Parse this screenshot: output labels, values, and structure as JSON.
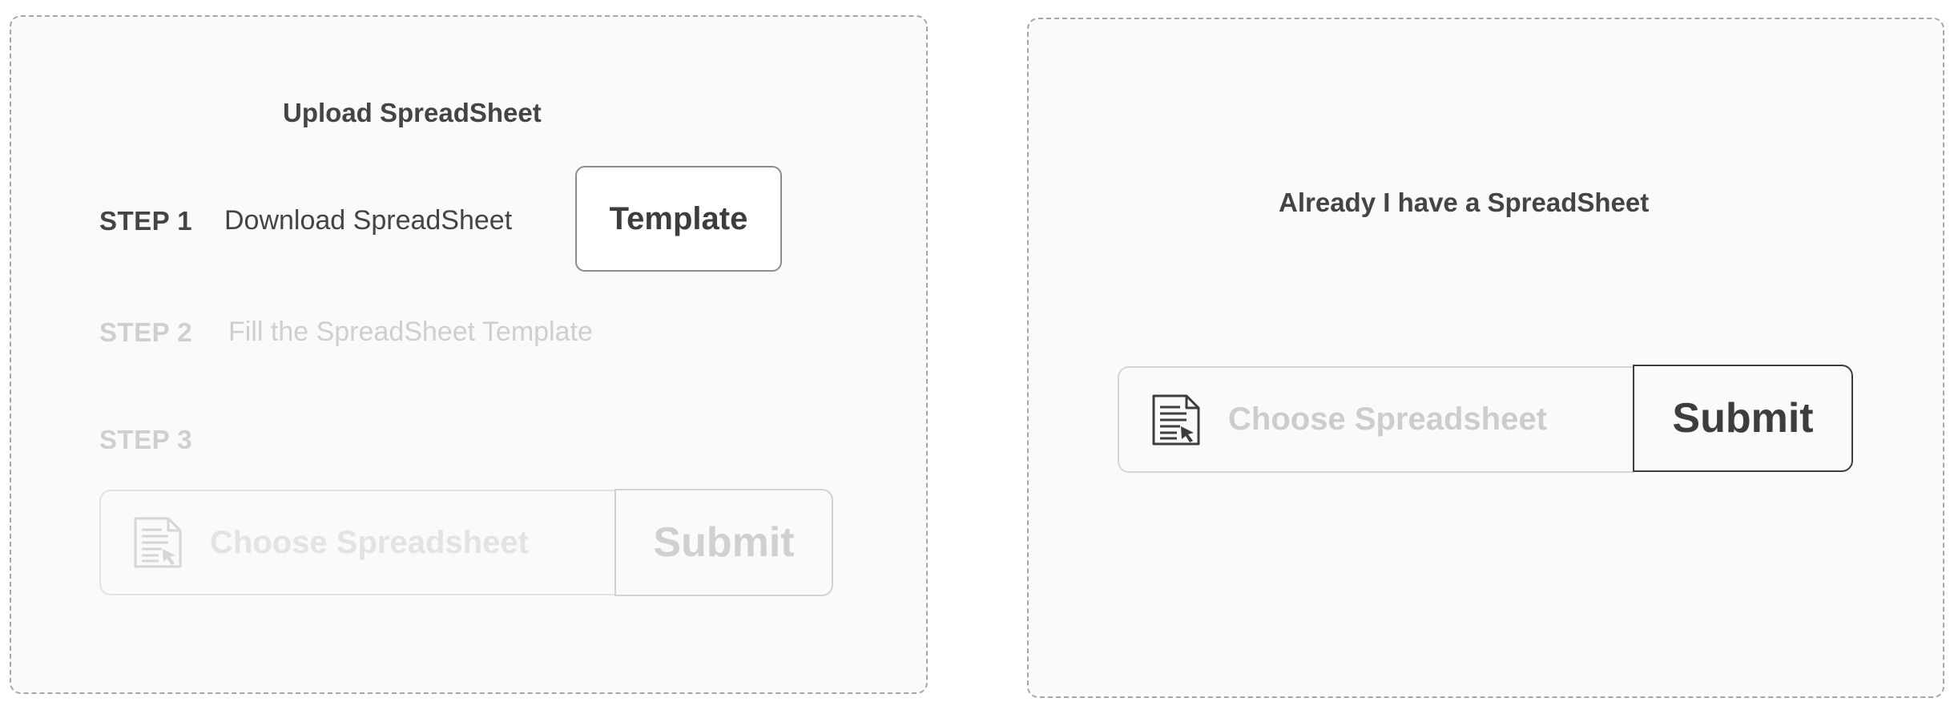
{
  "upload_panel": {
    "title": "Upload SpreadSheet",
    "steps": [
      {
        "label": "STEP 1",
        "text": "Download SpreadSheet",
        "button": "Template"
      },
      {
        "label": "STEP 2",
        "text": "Fill the SpreadSheet Template"
      },
      {
        "label": "STEP 3"
      }
    ],
    "file_picker": {
      "placeholder": "Choose Spreadsheet",
      "icon": "document-cursor-icon",
      "submit_label": "Submit",
      "disabled": true
    }
  },
  "existing_panel": {
    "title": "Already I have a SpreadSheet",
    "file_picker": {
      "placeholder": "Choose Spreadsheet",
      "icon": "document-cursor-icon",
      "submit_label": "Submit",
      "disabled": false
    }
  },
  "colors": {
    "panel_background": "#fafafa",
    "panel_border": "#a6a6a6",
    "text_dark": "#444444",
    "text_disabled": "#cfcfcf"
  }
}
